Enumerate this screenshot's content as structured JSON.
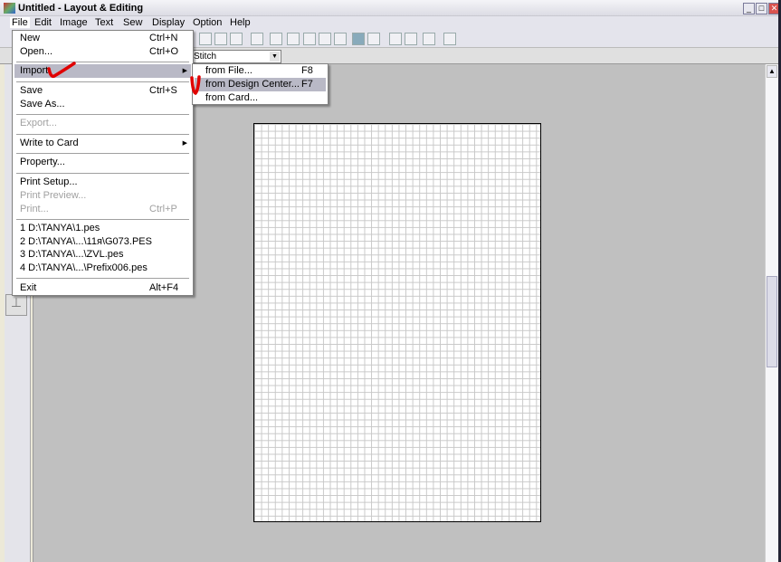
{
  "window": {
    "title": "Untitled - Layout & Editing",
    "minimize": "_",
    "maximize": "□",
    "close": "✕"
  },
  "menubar": [
    "File",
    "Edit",
    "Image",
    "Text",
    "Sew",
    "Display",
    "Option",
    "Help"
  ],
  "toolbar": {
    "combo_value": "Stitch"
  },
  "file_menu": {
    "new": {
      "label": "New",
      "shortcut": "Ctrl+N"
    },
    "open": {
      "label": "Open...",
      "shortcut": "Ctrl+O"
    },
    "import": {
      "label": "Import"
    },
    "save": {
      "label": "Save",
      "shortcut": "Ctrl+S"
    },
    "save_as": {
      "label": "Save As..."
    },
    "export": {
      "label": "Export..."
    },
    "write_to_card": {
      "label": "Write to Card"
    },
    "property": {
      "label": "Property..."
    },
    "print_setup": {
      "label": "Print Setup..."
    },
    "print_preview": {
      "label": "Print Preview..."
    },
    "print": {
      "label": "Print...",
      "shortcut": "Ctrl+P"
    },
    "recent": [
      "1 D:\\TANYA\\1.pes",
      "2 D:\\TANYA\\...\\11я\\G073.PES",
      "3 D:\\TANYA\\...\\ZVL.pes",
      "4 D:\\TANYA\\...\\Prefix006.pes"
    ],
    "exit": {
      "label": "Exit",
      "shortcut": "Alt+F4"
    }
  },
  "import_submenu": [
    {
      "label": "from File...",
      "shortcut": "F8"
    },
    {
      "label": "from Design Center...",
      "shortcut": "F7"
    },
    {
      "label": "from Card..."
    }
  ],
  "colors": {
    "highlight": "#b9b9c6",
    "annotation": "#e00000",
    "workspace": "#c0c0c0"
  }
}
